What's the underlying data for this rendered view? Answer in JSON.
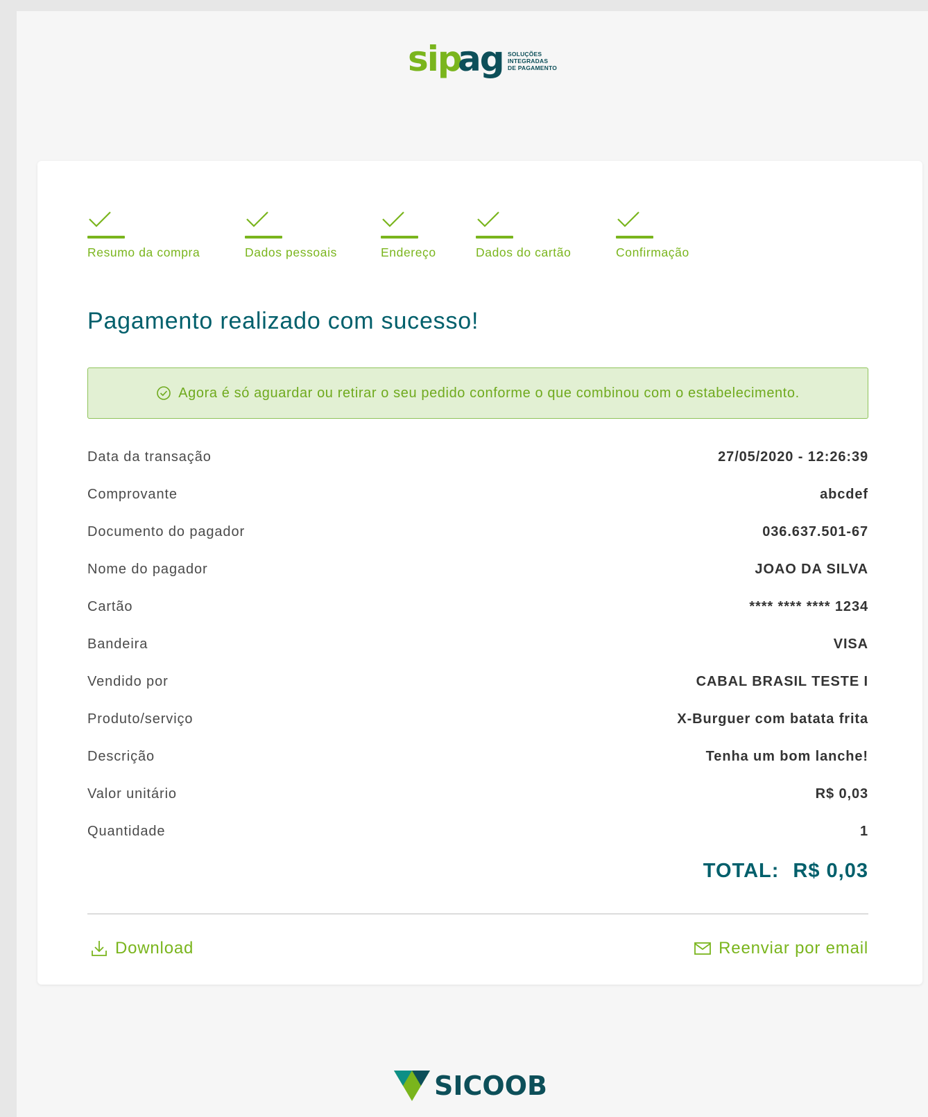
{
  "brand": {
    "logo_text": "sipag",
    "tagline": "SOLUÇÕES INTEGRADAS DE PAGAMENTO",
    "footer_logo_text": "SICOOB",
    "colors": {
      "green": "#7ab51d",
      "teal": "#005f6b",
      "alert_bg": "#e2f0d3"
    }
  },
  "steps": [
    {
      "label": "Resumo da compra",
      "icon": "check-icon",
      "status": "completed"
    },
    {
      "label": "Dados pessoais",
      "icon": "check-icon",
      "status": "completed"
    },
    {
      "label": "Endereço",
      "icon": "check-icon",
      "status": "completed"
    },
    {
      "label": "Dados do cartão",
      "icon": "check-icon",
      "status": "completed"
    },
    {
      "label": "Confirmação",
      "icon": "check-icon",
      "status": "completed"
    }
  ],
  "title": "Pagamento realizado com sucesso!",
  "alert": {
    "icon": "check-circle-icon",
    "text": "Agora é só aguardar ou retirar o seu pedido conforme o que combinou com o estabelecimento."
  },
  "details": [
    {
      "label": "Data da transação",
      "value": "27/05/2020 - 12:26:39"
    },
    {
      "label": "Comprovante",
      "value": "abcdef"
    },
    {
      "label": "Documento do pagador",
      "value": "036.637.501-67"
    },
    {
      "label": "Nome do pagador",
      "value": "JOAO DA SILVA"
    },
    {
      "label": "Cartão",
      "value": "**** **** **** 1234"
    },
    {
      "label": "Bandeira",
      "value": "VISA"
    },
    {
      "label": "Vendido por",
      "value": "CABAL BRASIL TESTE I"
    },
    {
      "label": "Produto/serviço",
      "value": "X-Burguer com batata frita"
    },
    {
      "label": "Descrição",
      "value": "Tenha um bom lanche!"
    },
    {
      "label": "Valor unitário",
      "value": "R$ 0,03"
    },
    {
      "label": "Quantidade",
      "value": "1"
    }
  ],
  "total": {
    "label": "TOTAL:",
    "value": "R$ 0,03"
  },
  "actions": {
    "download": {
      "label": "Download",
      "icon": "download-icon"
    },
    "resend": {
      "label": "Reenviar por email",
      "icon": "mail-icon"
    }
  }
}
